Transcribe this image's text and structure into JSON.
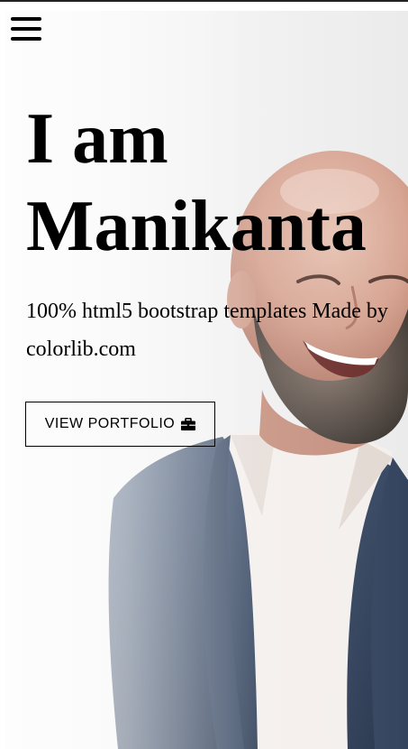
{
  "nav": {
    "menu_icon": "hamburger-menu-icon"
  },
  "hero": {
    "headline_line1": "I am",
    "headline_line2": "Manikanta",
    "subtitle": "100% html5 bootstrap templates Made by colorlib.com",
    "cta_label": "VIEW PORTFOLIO",
    "cta_icon": "briefcase-icon",
    "photo": "smiling-bald-bearded-man-in-navy-suit"
  }
}
